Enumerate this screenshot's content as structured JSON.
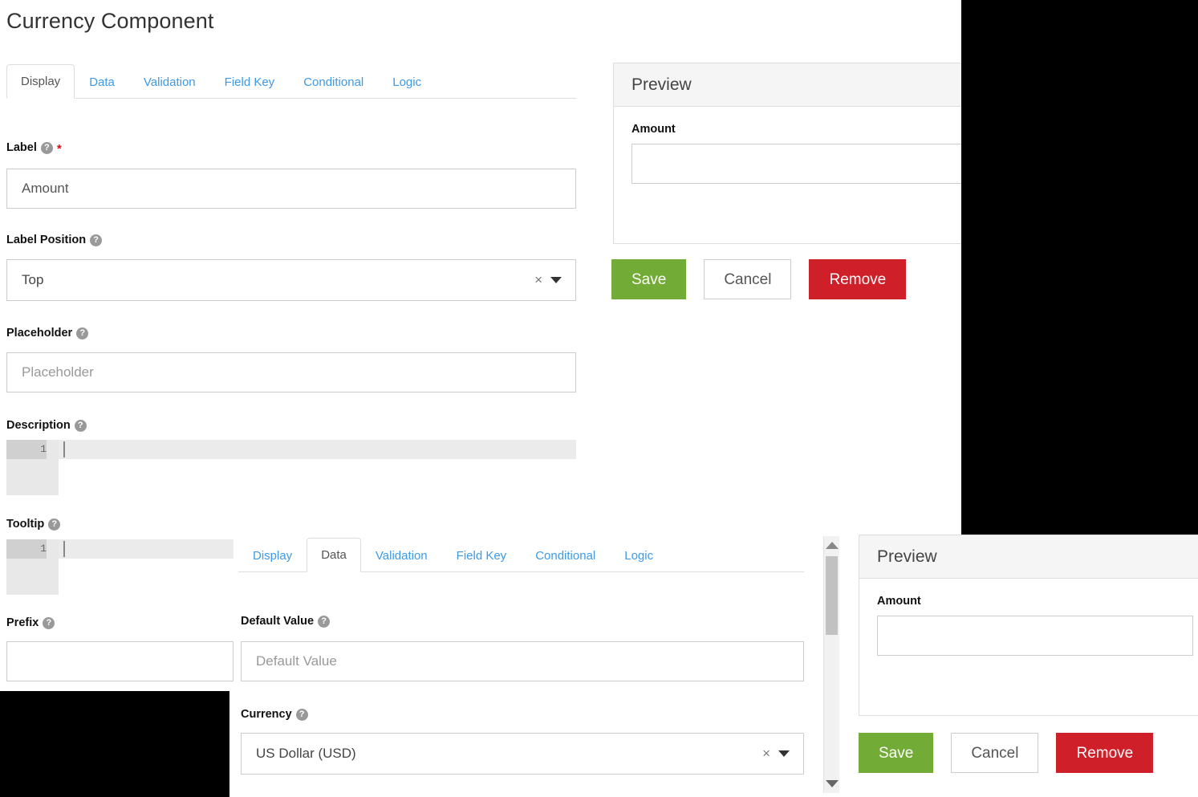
{
  "page": {
    "title": "Currency Component"
  },
  "colors": {
    "accent_link": "#3d9ae8",
    "save_green": "#72ab35",
    "remove_red": "#cf2029",
    "border_gray": "#cccccc",
    "panel_head_bg": "#f5f5f5",
    "required_star": "#e00b0b",
    "occluder_black": "#000000"
  },
  "top_dialog": {
    "tabs": [
      {
        "label": "Display",
        "active": true
      },
      {
        "label": "Data",
        "active": false
      },
      {
        "label": "Validation",
        "active": false
      },
      {
        "label": "Field Key",
        "active": false
      },
      {
        "label": "Conditional",
        "active": false
      },
      {
        "label": "Logic",
        "active": false
      }
    ],
    "fields": {
      "label": {
        "label": "Label",
        "required_marker": "*",
        "help": "?",
        "value": "Amount",
        "placeholder": ""
      },
      "label_position": {
        "label": "Label Position",
        "help": "?",
        "value": "Top",
        "clear_glyph": "×"
      },
      "placeholder": {
        "label": "Placeholder",
        "help": "?",
        "value": "",
        "placeholder": "Placeholder"
      },
      "description": {
        "label": "Description",
        "help": "?",
        "line_number": "1",
        "value": ""
      },
      "tooltip": {
        "label": "Tooltip",
        "help": "?",
        "line_number": "1",
        "value": ""
      },
      "prefix": {
        "label": "Prefix",
        "help": "?",
        "value": "",
        "placeholder": ""
      }
    },
    "preview": {
      "title": "Preview",
      "field_label": "Amount",
      "field_value": ""
    },
    "buttons": {
      "save": "Save",
      "cancel": "Cancel",
      "remove": "Remove"
    }
  },
  "bottom_dialog": {
    "tabs": [
      {
        "label": "Display",
        "active": false
      },
      {
        "label": "Data",
        "active": true
      },
      {
        "label": "Validation",
        "active": false
      },
      {
        "label": "Field Key",
        "active": false
      },
      {
        "label": "Conditional",
        "active": false
      },
      {
        "label": "Logic",
        "active": false
      }
    ],
    "fields": {
      "default_value": {
        "label": "Default Value",
        "help": "?",
        "value": "",
        "placeholder": "Default Value"
      },
      "currency": {
        "label": "Currency",
        "help": "?",
        "value": "US Dollar (USD)",
        "clear_glyph": "×"
      }
    },
    "preview": {
      "title": "Preview",
      "field_label": "Amount",
      "field_value": ""
    },
    "buttons": {
      "save": "Save",
      "cancel": "Cancel",
      "remove": "Remove"
    },
    "scrollbar": {
      "up_arrow": "▲",
      "down_arrow": "▼"
    }
  }
}
